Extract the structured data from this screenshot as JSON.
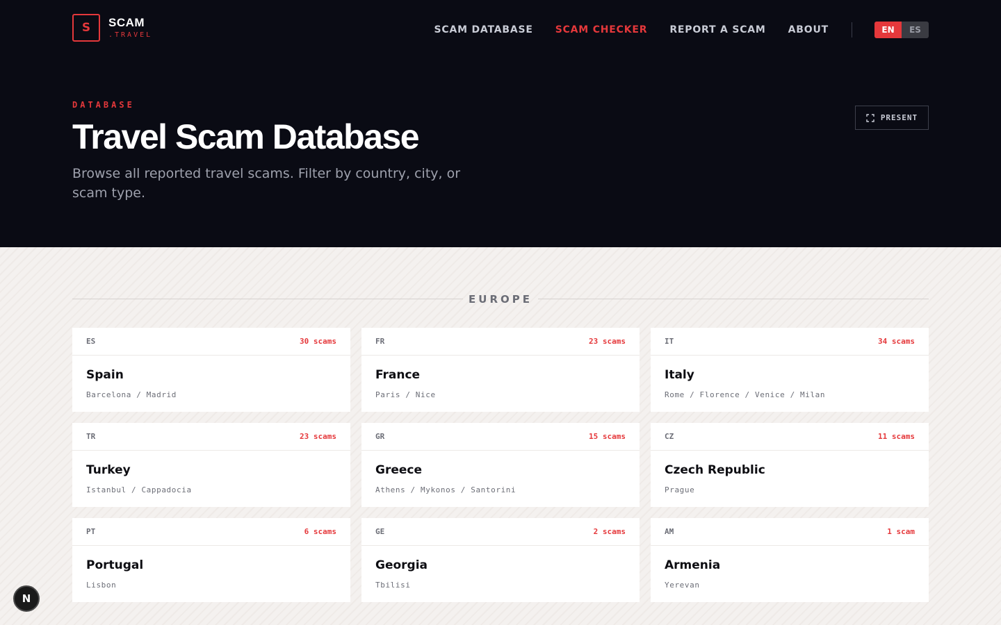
{
  "brand": {
    "mark": "S",
    "name": "SCAM",
    "suffix": ".TRAVEL"
  },
  "nav": {
    "items": [
      {
        "label": "SCAM DATABASE"
      },
      {
        "label": "SCAM CHECKER"
      },
      {
        "label": "REPORT A SCAM"
      },
      {
        "label": "ABOUT"
      }
    ],
    "lang": {
      "en": "EN",
      "es": "ES"
    }
  },
  "hero": {
    "eyebrow": "DATABASE",
    "title": "Travel Scam Database",
    "subtitle": "Browse all reported travel scams. Filter by country, city, or scam type.",
    "present_label": "PRESENT"
  },
  "region": {
    "label": "EUROPE"
  },
  "countries": [
    {
      "code": "ES",
      "count": "30 scams",
      "name": "Spain",
      "cities": "Barcelona / Madrid"
    },
    {
      "code": "FR",
      "count": "23 scams",
      "name": "France",
      "cities": "Paris / Nice"
    },
    {
      "code": "IT",
      "count": "34 scams",
      "name": "Italy",
      "cities": "Rome / Florence / Venice / Milan"
    },
    {
      "code": "TR",
      "count": "23 scams",
      "name": "Turkey",
      "cities": "Istanbul / Cappadocia"
    },
    {
      "code": "GR",
      "count": "15 scams",
      "name": "Greece",
      "cities": "Athens / Mykonos / Santorini"
    },
    {
      "code": "CZ",
      "count": "11 scams",
      "name": "Czech Republic",
      "cities": "Prague"
    },
    {
      "code": "PT",
      "count": "6 scams",
      "name": "Portugal",
      "cities": "Lisbon"
    },
    {
      "code": "GE",
      "count": "2 scams",
      "name": "Georgia",
      "cities": "Tbilisi"
    },
    {
      "code": "AM",
      "count": "1 scam",
      "name": "Armenia",
      "cities": "Yerevan"
    }
  ],
  "fab": {
    "label": "N"
  },
  "colors": {
    "accent": "#e5383b",
    "header_bg": "#0a0b14",
    "content_bg": "#f4f1ef"
  }
}
